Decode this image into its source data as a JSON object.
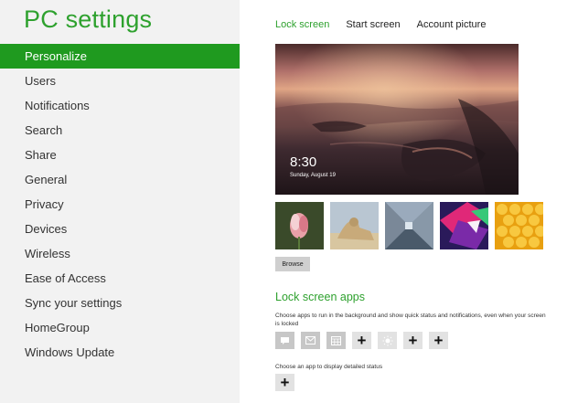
{
  "app": {
    "title": "PC settings"
  },
  "sidebar": {
    "items": [
      {
        "label": "Personalize",
        "active": true
      },
      {
        "label": "Users"
      },
      {
        "label": "Notifications"
      },
      {
        "label": "Search"
      },
      {
        "label": "Share"
      },
      {
        "label": "General"
      },
      {
        "label": "Privacy"
      },
      {
        "label": "Devices"
      },
      {
        "label": "Wireless"
      },
      {
        "label": "Ease of Access"
      },
      {
        "label": "Sync your settings"
      },
      {
        "label": "HomeGroup"
      },
      {
        "label": "Windows Update"
      }
    ]
  },
  "tabs": [
    {
      "label": "Lock screen",
      "active": true
    },
    {
      "label": "Start screen"
    },
    {
      "label": "Account picture"
    }
  ],
  "lock_preview": {
    "time": "8:30",
    "date": "Sunday, August 19"
  },
  "thumbnails": [
    "flower",
    "sphinx",
    "tunnel",
    "color-shapes",
    "honeycomb"
  ],
  "browse_label": "Browse",
  "lock_apps": {
    "title": "Lock screen apps",
    "description": "Choose apps to run in the background and show quick status and notifications, even when your screen is locked",
    "slots": [
      {
        "icon": "messaging-icon",
        "state": "assigned"
      },
      {
        "icon": "mail-icon",
        "state": "assigned"
      },
      {
        "icon": "calendar-icon",
        "state": "assigned"
      },
      {
        "icon": "plus-icon",
        "state": "empty"
      },
      {
        "icon": "weather-sun-icon",
        "state": "assigned"
      },
      {
        "icon": "plus-icon",
        "state": "empty"
      },
      {
        "icon": "plus-icon",
        "state": "empty"
      }
    ],
    "detail_description": "Choose an app to display detailed status"
  },
  "colors": {
    "accent": "#2ea12e",
    "active_nav": "#1f9a1f",
    "sidebar_bg": "#f2f2f2"
  }
}
